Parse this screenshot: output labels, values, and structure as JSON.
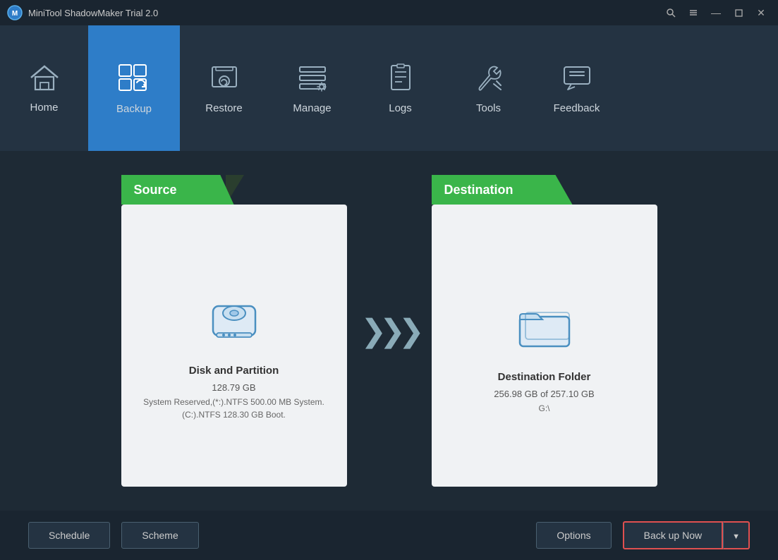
{
  "titleBar": {
    "title": "MiniTool ShadowMaker Trial 2.0",
    "controls": [
      "search",
      "menu",
      "minimize",
      "maximize",
      "close"
    ]
  },
  "nav": {
    "items": [
      {
        "id": "home",
        "label": "Home",
        "active": false
      },
      {
        "id": "backup",
        "label": "Backup",
        "active": true
      },
      {
        "id": "restore",
        "label": "Restore",
        "active": false
      },
      {
        "id": "manage",
        "label": "Manage",
        "active": false
      },
      {
        "id": "logs",
        "label": "Logs",
        "active": false
      },
      {
        "id": "tools",
        "label": "Tools",
        "active": false
      },
      {
        "id": "feedback",
        "label": "Feedback",
        "active": false
      }
    ]
  },
  "source": {
    "header": "Source",
    "title": "Disk and Partition",
    "size": "128.79 GB",
    "detail": "System Reserved,(*:).NTFS 500.00 MB System.\n(C:).NTFS 128.30 GB Boot."
  },
  "destination": {
    "header": "Destination",
    "title": "Destination Folder",
    "size": "256.98 GB of 257.10 GB",
    "path": "G:\\"
  },
  "bottomBar": {
    "scheduleLabel": "Schedule",
    "schemeLabel": "Scheme",
    "optionsLabel": "Options",
    "backupNowLabel": "Back up Now",
    "dropdownArrow": "▼"
  }
}
